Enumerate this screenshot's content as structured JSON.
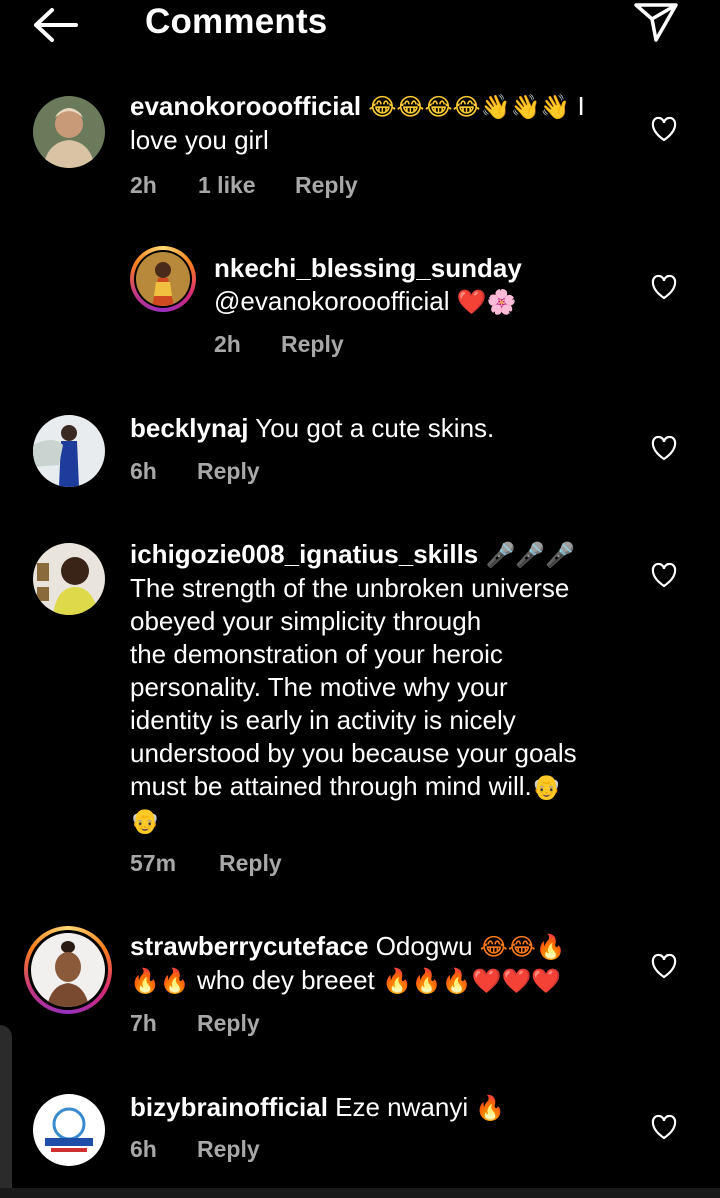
{
  "header": {
    "title": "Comments",
    "back_icon": "arrow-left-icon",
    "send_icon": "paper-plane-icon"
  },
  "comments": [
    {
      "username": "evanokorooofficial",
      "emojis": "😂😂😂😂👋👋👋",
      "text_after_emoji": " I",
      "text_line2": "love you girl",
      "time": "2h",
      "likes": "1 like",
      "reply": "Reply"
    },
    {
      "username": "nkechi_blessing_sunday",
      "mention": "@evanokorooofficial",
      "emojis": "❤️🌸",
      "time": "2h",
      "reply": "Reply"
    },
    {
      "username": "becklynaj",
      "text": " You got a cute skins.",
      "time": "6h",
      "reply": "Reply"
    },
    {
      "username": "ichigozie008_ignatius_skills",
      "emojis": "🎤🎤🎤",
      "lines": [
        "The strength of the unbroken universe",
        "obeyed your simplicity through",
        "the demonstration of your heroic",
        "personality. The motive why your",
        "identity is early in activity is nicely",
        "understood by you because your goals",
        "must be attained through mind will."
      ],
      "end_emoji": "👴",
      "end_emoji2": "👴",
      "time": "57m",
      "reply": "Reply"
    },
    {
      "username": "strawberrycuteface",
      "text": " Odogwu ",
      "emojis1": "😂😂🔥",
      "emojis2": "🔥🔥",
      "text2": "who dey breeet ",
      "emojis3": "🔥🔥🔥❤️❤️❤️",
      "time": "7h",
      "reply": "Reply"
    },
    {
      "username": "bizybrainofficial",
      "text": " Eze nwanyi ",
      "emojis": "🔥",
      "time": "6h",
      "reply": "Reply"
    }
  ],
  "colors": {
    "background": "#000000",
    "secondary_text": "#a8a8a8",
    "story_ring": "#d62976"
  }
}
